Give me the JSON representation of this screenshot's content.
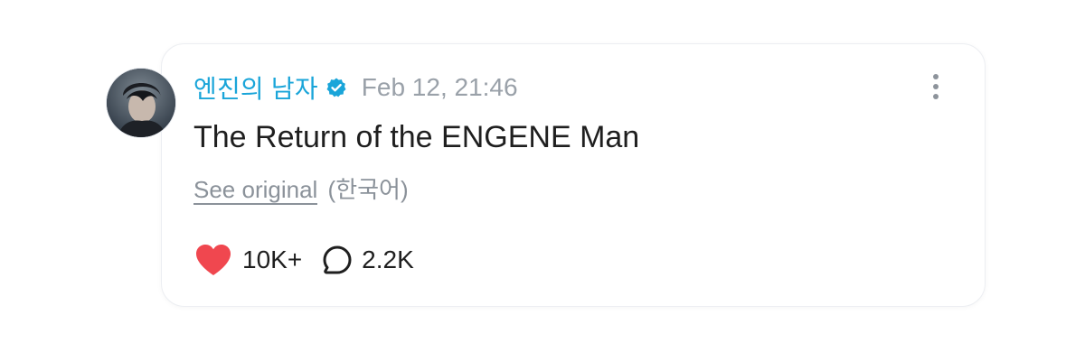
{
  "post": {
    "author": {
      "username": "엔진의 남자",
      "verified": true,
      "avatar_icon": "profile-photo"
    },
    "timestamp": "Feb 12, 21:46",
    "text": "The Return of the ENGENE Man",
    "translation": {
      "see_original_label": "See original",
      "language_label": "(한국어)"
    },
    "stats": {
      "likes": "10K+",
      "comments": "2.2K"
    }
  },
  "colors": {
    "username": "#1aa5d9",
    "verified_badge": "#1aa5d9",
    "heart": "#f0474f",
    "muted_text": "#9aa1a9",
    "primary_text": "#1f1f1f"
  },
  "icons": {
    "verified": "verified-badge-icon",
    "more": "more-vertical-icon",
    "like": "heart-icon",
    "comment": "comment-bubble-icon"
  }
}
